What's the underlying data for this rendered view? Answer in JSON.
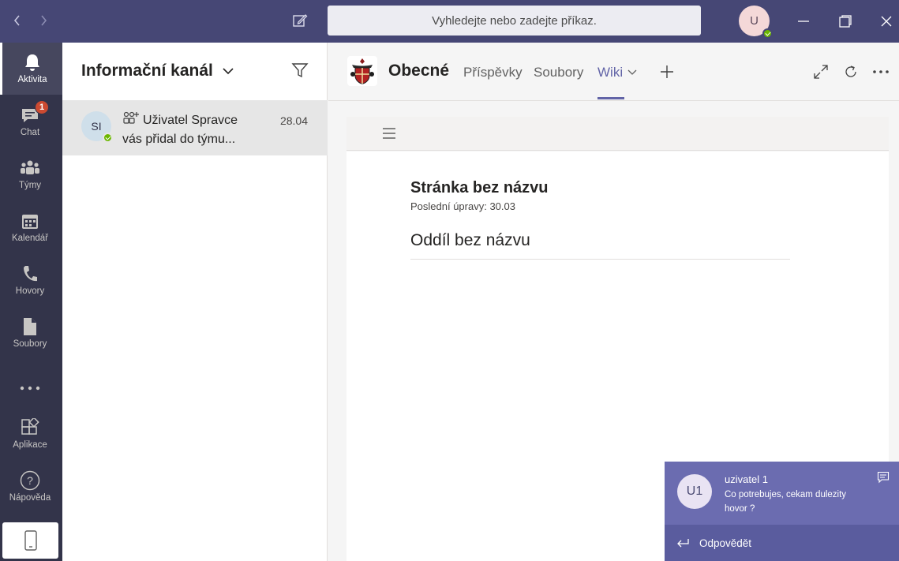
{
  "titlebar": {
    "search_placeholder": "Vyhledejte nebo zadejte příkaz.",
    "user_initial": "U"
  },
  "rail": {
    "items": [
      {
        "label": "Aktivita",
        "icon": "bell-icon",
        "active": true
      },
      {
        "label": "Chat",
        "icon": "chat-icon",
        "badge": "1"
      },
      {
        "label": "Týmy",
        "icon": "teams-icon"
      },
      {
        "label": "Kalendář",
        "icon": "calendar-icon"
      },
      {
        "label": "Hovory",
        "icon": "phone-icon"
      },
      {
        "label": "Soubory",
        "icon": "file-icon"
      },
      {
        "label": "Aplikace",
        "icon": "apps-icon"
      },
      {
        "label": "Nápověda",
        "icon": "help-icon"
      }
    ]
  },
  "activity": {
    "title": "Informační kanál",
    "feed": [
      {
        "avatar": "SI",
        "text": "Uživatel Spravce vás přidal do týmu...",
        "date": "28.04"
      }
    ]
  },
  "channel": {
    "name": "Obecné",
    "tabs": [
      "Příspěvky",
      "Soubory",
      "Wiki"
    ],
    "active_tab": "Wiki"
  },
  "wiki": {
    "page_title": "Stránka bez názvu",
    "last_edit": "Poslední úpravy: 30.03",
    "section_title": "Oddíl bez názvu"
  },
  "toast": {
    "avatar": "U1",
    "sender": "uzivatel 1",
    "message": "Co potrebujes, cekam dulezity hovor ?",
    "reply_label": "Odpovědět"
  },
  "colors": {
    "titlebar": "#464775",
    "rail": "#33344a",
    "accent": "#6264a7",
    "presence_available": "#6bb700",
    "badge": "#cc4a31"
  }
}
